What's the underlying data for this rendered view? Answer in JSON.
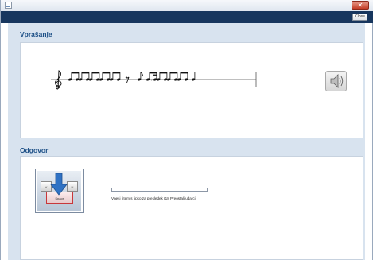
{
  "window": {
    "title": "",
    "close_glyph": "✕",
    "colors": {
      "toolbar": "#17365e",
      "panel": "#d8e3ef",
      "heading": "#1c4f86"
    }
  },
  "toolbar": {
    "close_label": "Close"
  },
  "question": {
    "title": "Vprašanje",
    "rhythm": [
      "beamed-eighths",
      "beamed-eighths",
      "beamed-eighths",
      "beamed-eighths",
      "beamed-eighths",
      "eighth-rest",
      "eighth-note",
      "dotted-eighth-sixteenth",
      "beamed-eighths",
      "beamed-eighths",
      "beamed-eighths",
      "quarter-note"
    ],
    "clef": "treble-clef",
    "play_icon": "speaker-icon"
  },
  "answer": {
    "title": "Odgovor",
    "keys": {
      "left": "V",
      "right": "N",
      "space": "Space"
    },
    "progress": 0,
    "status_text": "Vnesi ritem s tipko za presledek (18 Preostali udarci)"
  }
}
